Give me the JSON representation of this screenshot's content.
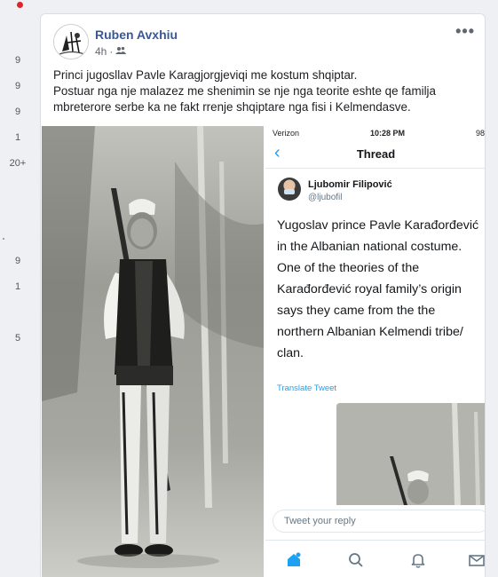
{
  "gutter": {
    "counts": [
      "9",
      "9",
      "9",
      "1",
      "20+",
      "9",
      "1",
      "5"
    ]
  },
  "post": {
    "author": "Ruben Avxhiu",
    "time": "4h",
    "separator": "·",
    "audience_icon": "friends-icon",
    "more": "•••",
    "text_line1": "Princi jugosllav Pavle Karagjorgjeviqi me kostum shqiptar.",
    "text_line2": "Postuar nga nje malazez me shenimin se nje nga teorite eshte qe familja mbreterore serbe ka ne fakt rrenje shqiptare nga fisi i Kelmendasve."
  },
  "tweet": {
    "carrier": "Verizon",
    "time": "10:28 PM",
    "battery": "98",
    "title": "Thread",
    "author_name": "Ljubomir Filipović",
    "author_handle": "@ljubofil",
    "text_lines": [
      "Yugoslav prince Pavle Karađorđević",
      "in the Albanian national costume.",
      "One of the theories of the",
      "Karađorđević royal family’s origin",
      "says they came from the the",
      "northern Albanian Kelmendi tribe/",
      "clan."
    ],
    "translate": "Translate Tweet",
    "reply_placeholder": "Tweet your reply"
  },
  "colors": {
    "facebook_link": "#385898",
    "twitter_blue": "#1da1f2",
    "notification_red": "#e0242a"
  }
}
